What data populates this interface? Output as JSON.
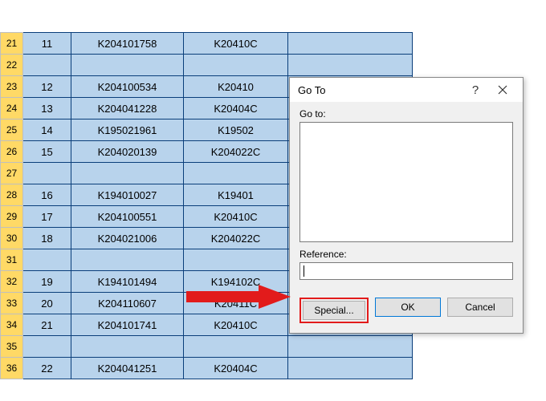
{
  "sheet": {
    "rows": [
      {
        "hdr": "21",
        "a": "11",
        "b": "K204101758",
        "c": "K20410C",
        "d": ""
      },
      {
        "hdr": "22",
        "a": "",
        "b": "",
        "c": "",
        "d": ""
      },
      {
        "hdr": "23",
        "a": "12",
        "b": "K204100534",
        "c": "K20410",
        "d": ""
      },
      {
        "hdr": "24",
        "a": "13",
        "b": "K204041228",
        "c": "K20404C",
        "d": ""
      },
      {
        "hdr": "25",
        "a": "14",
        "b": "K195021961",
        "c": "K19502",
        "d": ""
      },
      {
        "hdr": "26",
        "a": "15",
        "b": "K204020139",
        "c": "K204022C",
        "d": ""
      },
      {
        "hdr": "27",
        "a": "",
        "b": "",
        "c": "",
        "d": ""
      },
      {
        "hdr": "28",
        "a": "16",
        "b": "K194010027",
        "c": "K19401",
        "d": ""
      },
      {
        "hdr": "29",
        "a": "17",
        "b": "K204100551",
        "c": "K20410C",
        "d": ""
      },
      {
        "hdr": "30",
        "a": "18",
        "b": "K204021006",
        "c": "K204022C",
        "d": ""
      },
      {
        "hdr": "31",
        "a": "",
        "b": "",
        "c": "",
        "d": ""
      },
      {
        "hdr": "32",
        "a": "19",
        "b": "K194101494",
        "c": "K194102C",
        "d": ""
      },
      {
        "hdr": "33",
        "a": "20",
        "b": "K204110607",
        "c": "K20411C",
        "d": ""
      },
      {
        "hdr": "34",
        "a": "21",
        "b": "K204101741",
        "c": "K20410C",
        "d": ""
      },
      {
        "hdr": "35",
        "a": "",
        "b": "",
        "c": "",
        "d": ""
      },
      {
        "hdr": "36",
        "a": "22",
        "b": "K204041251",
        "c": "K20404C",
        "d": ""
      }
    ]
  },
  "dialog": {
    "title": "Go To",
    "help": "?",
    "goto_label": "Go to:",
    "reference_label": "Reference:",
    "reference_value": "",
    "buttons": {
      "special": "Special...",
      "ok": "OK",
      "cancel": "Cancel"
    }
  }
}
